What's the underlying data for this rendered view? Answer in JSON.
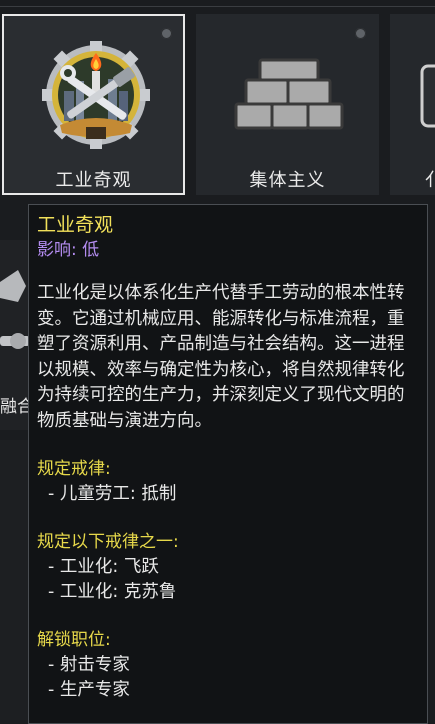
{
  "tiles": [
    {
      "label": "工业奇观",
      "selected": true
    },
    {
      "label": "集体主义",
      "selected": false
    },
    {
      "label": "亻",
      "selected": false
    }
  ],
  "left_fragment": {
    "label": "融合"
  },
  "tooltip": {
    "title": "工业奇观",
    "impact": "影响: 低",
    "description": "工业化是以体系化生产代替手工劳动的根本性转变。它通过机械应用、能源转化与标准流程，重塑了资源利用、产品制造与社会结构。这一进程以规模、效率与确定性为核心，将自然规律转化为持续可控的生产力，并深刻定义了现代文明的物质基础与演进方向。",
    "sections": [
      {
        "heading": "规定戒律:",
        "items": [
          "- 儿童劳工: 抵制"
        ]
      },
      {
        "heading": "规定以下戒律之一:",
        "items": [
          "- 工业化: 飞跃",
          "- 工业化: 克苏鲁"
        ]
      },
      {
        "heading": "解锁职位:",
        "items": [
          "- 射击专家",
          "- 生产专家"
        ]
      }
    ]
  },
  "colors": {
    "title": "#f1e05a",
    "impact": "#b48cf0",
    "heading": "#e6d84a"
  }
}
